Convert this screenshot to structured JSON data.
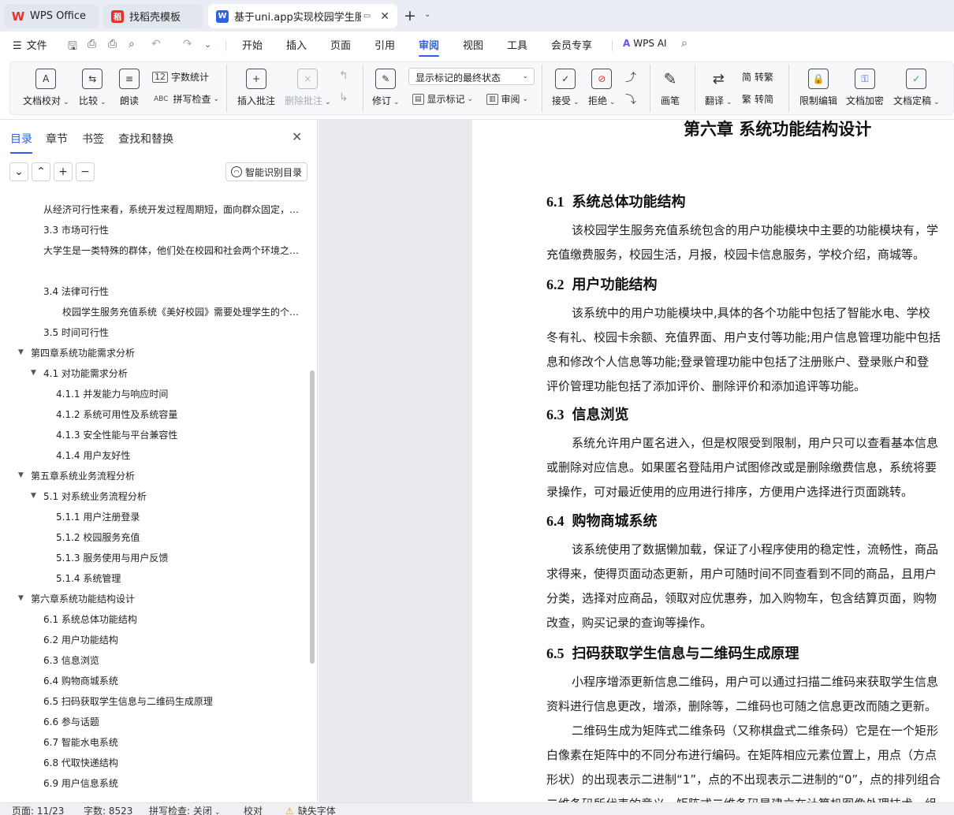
{
  "tabs": {
    "wps_office": "WPS Office",
    "template": "找稻壳模板",
    "document": "基于uni.app实现校园学生服务充值系统",
    "new_tab": "+"
  },
  "menu": {
    "file": "文件",
    "items": [
      "开始",
      "插入",
      "页面",
      "引用",
      "审阅",
      "视图",
      "工具",
      "会员专享"
    ],
    "wps_ai": "WPS AI"
  },
  "ribbon": {
    "doc_proofread": "文档校对",
    "compare": "比较",
    "read_aloud": "朗读",
    "word_count": "字数统计",
    "spell_check": "拼写检查",
    "insert_comment": "插入批注",
    "delete_comment": "删除批注",
    "track_changes": "修订",
    "markup_state": "显示标记的最终状态",
    "show_markup": "显示标记",
    "review_pane": "审阅",
    "accept": "接受",
    "reject": "拒绝",
    "pen": "画笔",
    "translate": "翻译",
    "to_traditional": "转繁",
    "to_simplified": "转简",
    "restrict_editing": "限制编辑",
    "encrypt_doc": "文档加密",
    "finalize_doc": "文档定稿"
  },
  "left_panel": {
    "tabs": [
      "目录",
      "章节",
      "书签",
      "查找和替换"
    ],
    "smart_toc": "智能识别目录",
    "toc": [
      {
        "text": "从经济可行性来看，系统开发过程周期短，面向群众固定，系统维护较简单，开发成本低…",
        "level": 3,
        "caret": false
      },
      {
        "text": "3.3  市场可行性",
        "level": 2,
        "caret": false
      },
      {
        "text": "大学生是一类特殊的群体，他们处在校园和社会两个环境之间，有着自己的消费特点和需求…",
        "level": 2,
        "caret": false
      },
      {
        "text": "",
        "level": 2,
        "caret": false
      },
      {
        "text": "3.4  法律可行性",
        "level": 2,
        "caret": false
      },
      {
        "text": "校园学生服务充值系统《美好校园》需要处理学生的个人信息和缴费信息，遵循相关法规…",
        "level": 3,
        "caret": false
      },
      {
        "text": "3.5  时间可行性",
        "level": 2,
        "caret": false
      },
      {
        "text": "第四章系统功能需求分析",
        "level": 1,
        "caret": true
      },
      {
        "text": "4.1  对功能需求分析",
        "level": 2,
        "caret": true
      },
      {
        "text": "4.1.1  并发能力与响应时间",
        "level": 3,
        "caret": false
      },
      {
        "text": "4.1.2  系统可用性及系统容量",
        "level": 3,
        "caret": false
      },
      {
        "text": "4.1.3  安全性能与平台兼容性",
        "level": 3,
        "caret": false
      },
      {
        "text": "4.1.4  用户友好性",
        "level": 3,
        "caret": false
      },
      {
        "text": "第五章系统业务流程分析",
        "level": 1,
        "caret": true
      },
      {
        "text": "5.1  对系统业务流程分析",
        "level": 2,
        "caret": true
      },
      {
        "text": "5.1.1  用户注册登录",
        "level": 3,
        "caret": false
      },
      {
        "text": "5.1.2  校园服务充值",
        "level": 3,
        "caret": false
      },
      {
        "text": "5.1.3  服务使用与用户反馈",
        "level": 3,
        "caret": false
      },
      {
        "text": "5.1.4  系统管理",
        "level": 3,
        "caret": false
      },
      {
        "text": "第六章系统功能结构设计",
        "level": 1,
        "caret": true
      },
      {
        "text": "6.1  系统总体功能结构",
        "level": 2,
        "caret": false
      },
      {
        "text": "6.2  用户功能结构",
        "level": 2,
        "caret": false
      },
      {
        "text": "6.3  信息浏览",
        "level": 2,
        "caret": false
      },
      {
        "text": "6.4  购物商城系统",
        "level": 2,
        "caret": false
      },
      {
        "text": "6.5  扫码获取学生信息与二维码生成原理",
        "level": 2,
        "caret": false
      },
      {
        "text": "6.6  参与话题",
        "level": 2,
        "caret": false
      },
      {
        "text": "6.7  智能水电系统",
        "level": 2,
        "caret": false
      },
      {
        "text": "6.8  代取快递结构",
        "level": 2,
        "caret": false
      },
      {
        "text": "6.9  用户信息系统",
        "level": 2,
        "caret": false
      }
    ]
  },
  "document": {
    "chapter_title": "第六章  系统功能结构设计",
    "sections": [
      {
        "num": "6.1",
        "title": "系统总体功能结构",
        "paras": [
          {
            "indent": true,
            "text": "该校园学生服务充值系统包含的用户功能模块中主要的功能模块有，学"
          },
          {
            "indent": false,
            "text": "充值缴费服务，校园生活，月报，校园卡信息服务，学校介绍，商城等。"
          }
        ]
      },
      {
        "num": "6.2",
        "title": "用户功能结构",
        "paras": [
          {
            "indent": true,
            "text": "该系统中的用户功能模块中,具体的各个功能中包括了智能水电、学校"
          },
          {
            "indent": false,
            "text": "冬有礼、校园卡余额、充值界面、用户支付等功能;用户信息管理功能中包括"
          },
          {
            "indent": false,
            "text": "息和修改个人信息等功能;登录管理功能中包括了注册账户、登录账户和登"
          },
          {
            "indent": false,
            "text": "评价管理功能包括了添加评价、删除评价和添加追评等功能。"
          }
        ]
      },
      {
        "num": "6.3",
        "title": "信息浏览",
        "paras": [
          {
            "indent": true,
            "text": "系统允许用户匿名进入，但是权限受到限制，用户只可以查看基本信息"
          },
          {
            "indent": false,
            "text": "或删除对应信息。如果匿名登陆用户试图修改或是删除缴费信息，系统将要"
          },
          {
            "indent": false,
            "text": "录操作，可对最近使用的应用进行排序，方便用户选择进行页面跳转。"
          }
        ]
      },
      {
        "num": "6.4",
        "title": "购物商城系统",
        "paras": [
          {
            "indent": true,
            "text": "该系统使用了数据懒加载，保证了小程序使用的稳定性，流畅性，商品"
          },
          {
            "indent": false,
            "text": "求得来，使得页面动态更新，用户可随时间不同查看到不同的商品，且用户"
          },
          {
            "indent": false,
            "text": "分类，选择对应商品，领取对应优惠券，加入购物车，包含结算页面，购物"
          },
          {
            "indent": false,
            "text": "改查，购买记录的查询等操作。"
          }
        ]
      },
      {
        "num": "6.5",
        "title": "扫码获取学生信息与二维码生成原理",
        "paras": [
          {
            "indent": true,
            "text": "小程序增添更新信息二维码，用户可以通过扫描二维码来获取学生信息"
          },
          {
            "indent": false,
            "text": "资料进行信息更改，增添，删除等，二维码也可随之信息更改而随之更新。"
          },
          {
            "indent": true,
            "text": "二维码生成为矩阵式二维条码（又称棋盘式二维条码）它是在一个矩形"
          },
          {
            "indent": false,
            "text": "白像素在矩阵中的不同分布进行编码。在矩阵相应元素位置上，用点（方点"
          },
          {
            "indent": false,
            "text": "形状）的出现表示二进制“1”，点的不出现表示二进制的“0”，点的排列组合"
          },
          {
            "indent": false,
            "text": "二维条码所代表的意义。矩阵式二维条码是建立在计算机图像处理技术、组"
          }
        ]
      }
    ]
  },
  "status": {
    "page": "页面: 11/23",
    "word_count": "字数: 8523",
    "spell": "拼写检查: 关闭",
    "proofread": "校对",
    "missing_font": "缺失字体"
  }
}
